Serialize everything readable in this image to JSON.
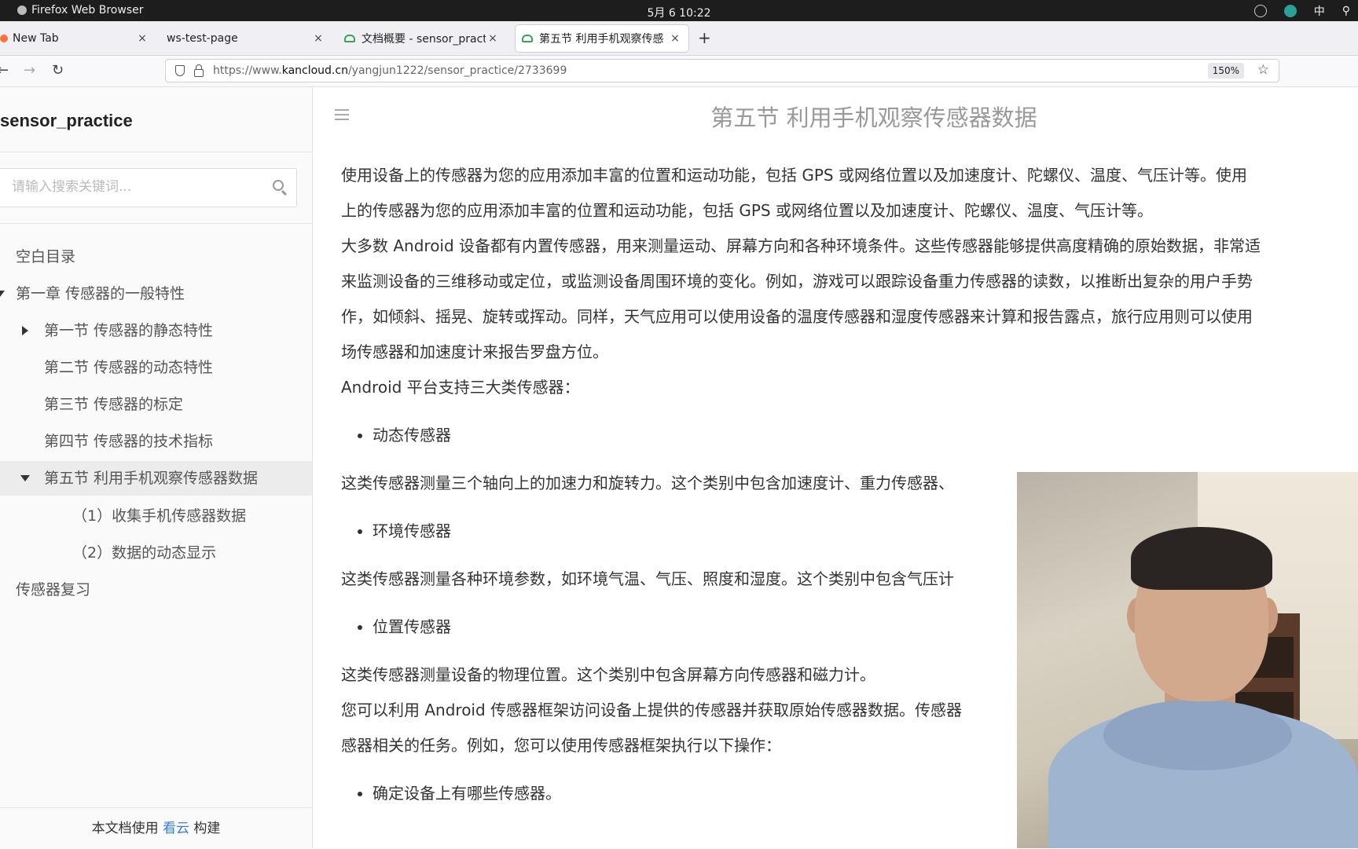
{
  "os": {
    "app_name": "Firefox Web Browser",
    "clock": "5月 6  10:22",
    "input_method": "中"
  },
  "tabs": [
    {
      "label": "New Tab",
      "close": "×"
    },
    {
      "label": "ws-test-page",
      "close": "×"
    },
    {
      "label": "文档概要 - sensor_practic",
      "close": "×"
    },
    {
      "label": "第五节 利用手机观察传感",
      "close": "×"
    }
  ],
  "new_tab": "+",
  "nav": {
    "url_prefix": "https://www.",
    "url_domain": "kancloud.cn",
    "url_path": "/yangjun1222/sensor_practice/2733699",
    "zoom": "150%"
  },
  "sidebar": {
    "book_title": "sensor_practice",
    "search_placeholder": "请输入搜索关键词...",
    "items": [
      {
        "label": "空白目录"
      },
      {
        "label": "第一章 传感器的一般特性"
      },
      {
        "label": "第一节 传感器的静态特性"
      },
      {
        "label": "第二节 传感器的动态特性"
      },
      {
        "label": "第三节 传感器的标定"
      },
      {
        "label": "第四节 传感器的技术指标"
      },
      {
        "label": "第五节 利用手机观察传感器数据"
      },
      {
        "label": "（1）收集手机传感器数据"
      },
      {
        "label": "（2）数据的动态显示"
      },
      {
        "label": "传感器复习"
      }
    ],
    "footer_pre": "本文档使用 ",
    "footer_link": "看云",
    "footer_post": " 构建"
  },
  "article": {
    "title": "第五节 利用手机观察传感器数据",
    "p1_l1": "使用设备上的传感器为您的应用添加丰富的位置和运动功能，包括 GPS 或网络位置以及加速度计、陀螺仪、温度、气压计等。使用",
    "p1_l2": "上的传感器为您的应用添加丰富的位置和运动功能，包括 GPS 或网络位置以及加速度计、陀螺仪、温度、气压计等。",
    "p2_l1": "大多数 Android 设备都有内置传感器，用来测量运动、屏幕方向和各种环境条件。这些传感器能够提供高度精确的原始数据，非常适",
    "p2_l2": "来监测设备的三维移动或定位，或监测设备周围环境的变化。例如，游戏可以跟踪设备重力传感器的读数，以推断出复杂的用户手势",
    "p2_l3": "作，如倾斜、摇晃、旋转或挥动。同样，天气应用可以使用设备的温度传感器和湿度传感器来计算和报告露点，旅行应用则可以使用",
    "p2_l4": "场传感器和加速度计来报告罗盘方位。",
    "p3": "Android 平台支持三大类传感器：",
    "b1": "动态传感器",
    "p4": "这类传感器测量三个轴向上的加速力和旋转力。这个类别中包含加速度计、重力传感器、",
    "b2": "环境传感器",
    "p5": "这类传感器测量各种环境参数，如环境气温、气压、照度和湿度。这个类别中包含气压计",
    "b3": "位置传感器",
    "p6": "这类传感器测量设备的物理位置。这个类别中包含屏幕方向传感器和磁力计。",
    "p7_l1": "您可以利用 Android 传感器框架访问设备上提供的传感器并获取原始传感器数据。传感器",
    "p7_l2": "感器相关的任务。例如，您可以使用传感器框架执行以下操作：",
    "b4": "确定设备上有哪些传感器。"
  }
}
